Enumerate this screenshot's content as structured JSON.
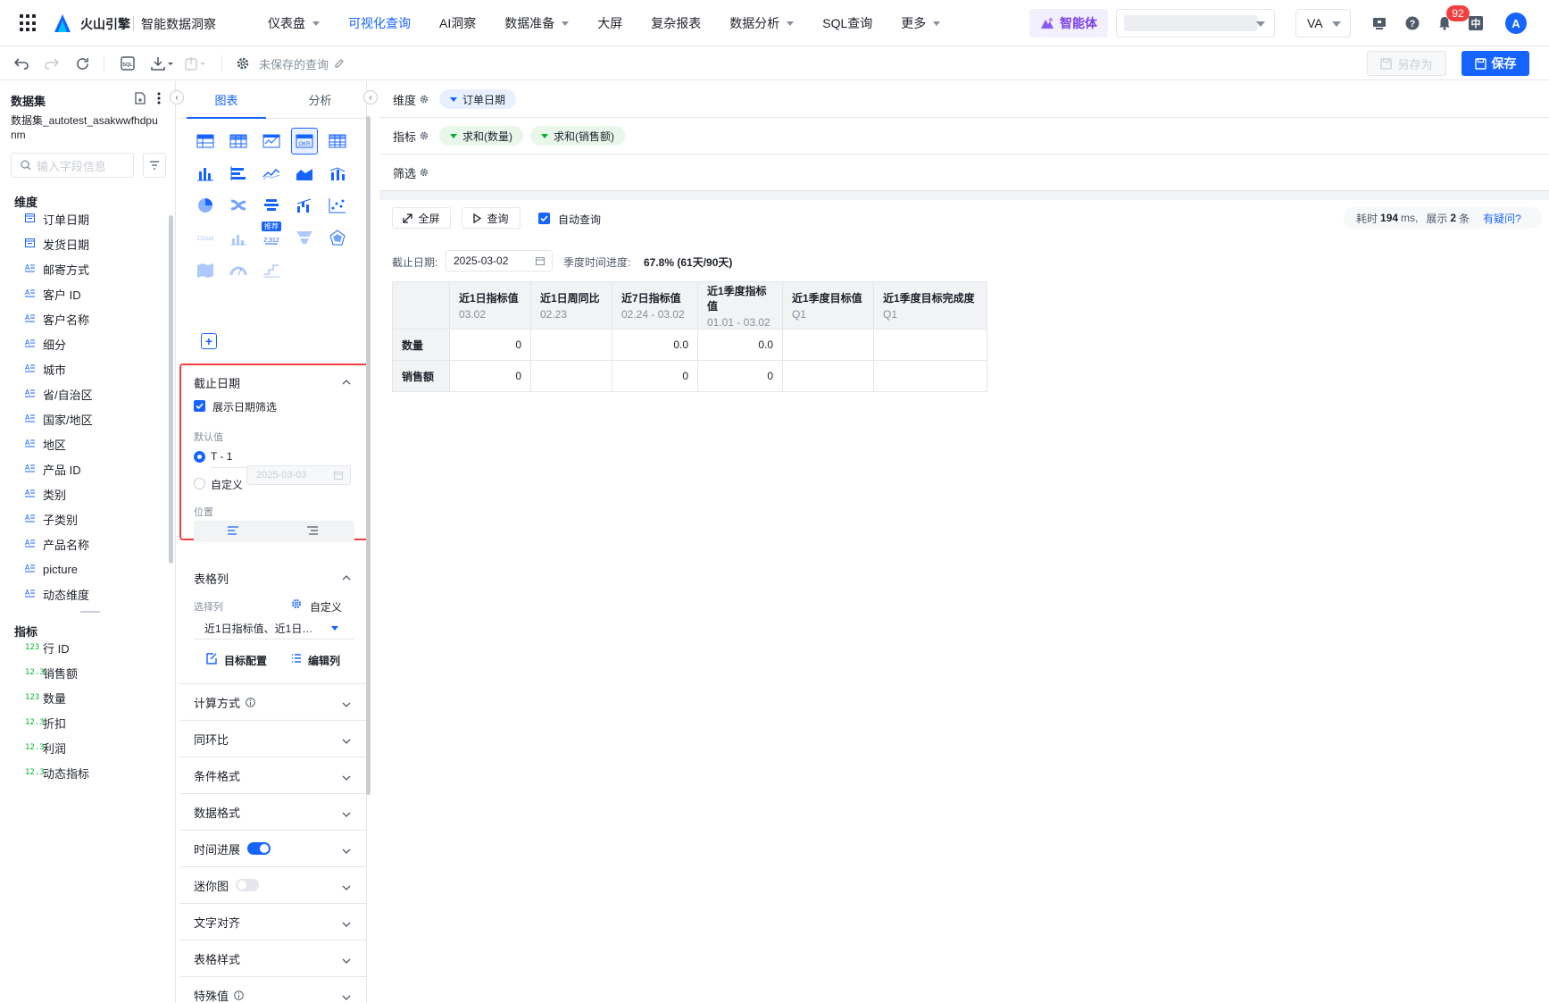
{
  "topnav": {
    "brand": "火山引擎",
    "product": "智能数据洞察",
    "items": [
      {
        "label": "仪表盘",
        "caret": true,
        "active": false
      },
      {
        "label": "可视化查询",
        "caret": false,
        "active": true
      },
      {
        "label": "AI洞察",
        "caret": false,
        "active": false
      },
      {
        "label": "数据准备",
        "caret": true,
        "active": false
      },
      {
        "label": "大屏",
        "caret": false,
        "active": false
      },
      {
        "label": "复杂报表",
        "caret": false,
        "active": false
      },
      {
        "label": "数据分析",
        "caret": true,
        "active": false
      },
      {
        "label": "SQL查询",
        "caret": false,
        "active": false
      },
      {
        "label": "更多",
        "caret": true,
        "active": false
      }
    ],
    "agent_label": "智能体",
    "workspace_label": "VA",
    "notification_count": "92",
    "lang_label": "中",
    "avatar_initial": "A"
  },
  "toolbar": {
    "query_name": "未保存的查询",
    "save_as_label": "另存为",
    "save_label": "保存"
  },
  "dataset": {
    "title": "数据集",
    "name": "数据集_autotest_asakwwfhdpunm",
    "search_placeholder": "输入字段信息",
    "dimensions_label": "维度",
    "dimensions": [
      {
        "icon": "date",
        "label": "订单日期"
      },
      {
        "icon": "date",
        "label": "发货日期"
      },
      {
        "icon": "text",
        "label": "邮寄方式"
      },
      {
        "icon": "text",
        "label": "客户 ID"
      },
      {
        "icon": "text",
        "label": "客户名称"
      },
      {
        "icon": "text",
        "label": "细分"
      },
      {
        "icon": "text",
        "label": "城市"
      },
      {
        "icon": "text",
        "label": "省/自治区"
      },
      {
        "icon": "text",
        "label": "国家/地区"
      },
      {
        "icon": "text",
        "label": "地区"
      },
      {
        "icon": "text",
        "label": "产品 ID"
      },
      {
        "icon": "text",
        "label": "类别"
      },
      {
        "icon": "text",
        "label": "子类别"
      },
      {
        "icon": "text",
        "label": "产品名称"
      },
      {
        "icon": "text",
        "label": "picture"
      },
      {
        "icon": "text",
        "label": "动态维度"
      }
    ],
    "metrics_label": "指标",
    "metrics": [
      {
        "icon": "int",
        "label": "行 ID"
      },
      {
        "icon": "float",
        "label": "销售额"
      },
      {
        "icon": "int",
        "label": "数量"
      },
      {
        "icon": "float",
        "label": "折扣"
      },
      {
        "icon": "float",
        "label": "利润"
      },
      {
        "icon": "float",
        "label": "动态指标"
      }
    ]
  },
  "config": {
    "tabs": [
      {
        "label": "图表",
        "active": true
      },
      {
        "label": "分析",
        "active": false
      }
    ],
    "chart_tag": "推荐",
    "chart_tag_value": "2,312",
    "cutoff": {
      "title": "截止日期",
      "show_filter_label": "展示日期筛选",
      "default_label": "默认值",
      "option_t1": "T - 1",
      "option_custom": "自定义",
      "custom_date": "2025-03-03",
      "position_label": "位置"
    },
    "columns": {
      "title": "表格列",
      "select_label": "选择列",
      "custom_label": "自定义",
      "selected_value": "近1日指标值、近1日…",
      "target_config_label": "目标配置",
      "edit_columns_label": "编辑列"
    },
    "sections": [
      {
        "label": "计算方式",
        "info": true,
        "toggle": null
      },
      {
        "label": "同环比",
        "info": false,
        "toggle": null
      },
      {
        "label": "条件格式",
        "info": false,
        "toggle": null
      },
      {
        "label": "数据格式",
        "info": false,
        "toggle": null
      },
      {
        "label": "时间进展",
        "info": false,
        "toggle": "on"
      },
      {
        "label": "迷你图",
        "info": false,
        "toggle": "off"
      },
      {
        "label": "文字对齐",
        "info": false,
        "toggle": null
      },
      {
        "label": "表格样式",
        "info": false,
        "toggle": null
      },
      {
        "label": "特殊值",
        "info": true,
        "toggle": null
      }
    ]
  },
  "shelves": {
    "dimension_label": "维度",
    "dimensions": [
      "订单日期"
    ],
    "metric_label": "指标",
    "metrics": [
      "求和(数量)",
      "求和(销售额)"
    ],
    "filter_label": "筛选"
  },
  "result": {
    "fullscreen_label": "全屏",
    "query_label": "查询",
    "auto_query_label": "自动查询",
    "timing_prefix": "耗时",
    "timing_ms": "194",
    "timing_ms_unit": "ms,",
    "timing_show": "展示",
    "timing_rows": "2",
    "timing_rows_unit": "条",
    "help_link": "有疑问?",
    "cutoff_label": "截止日期:",
    "cutoff_value": "2025-03-02",
    "progress_label": "季度时间进度:",
    "progress_value": "67.8% (61天/90天)",
    "table": {
      "headers": [
        {
          "title": "近1日指标值",
          "sub": "03.02"
        },
        {
          "title": "近1日周同比",
          "sub": "02.23"
        },
        {
          "title": "近7日指标值",
          "sub": "02.24 - 03.02"
        },
        {
          "title": "近1季度指标值",
          "sub": "01.01 - 03.02"
        },
        {
          "title": "近1季度目标值",
          "sub": "Q1"
        },
        {
          "title": "近1季度目标完成度",
          "sub": "Q1"
        }
      ],
      "rows": [
        {
          "label": "数量",
          "cells": [
            "0",
            "",
            "0.0",
            "0.0",
            "",
            ""
          ]
        },
        {
          "label": "销售额",
          "cells": [
            "0",
            "",
            "0",
            "0",
            "",
            ""
          ]
        }
      ]
    }
  },
  "colors": {
    "accent": "#1664ff",
    "highlight_border": "#f53f3f",
    "agent": "#7b3fe4"
  }
}
